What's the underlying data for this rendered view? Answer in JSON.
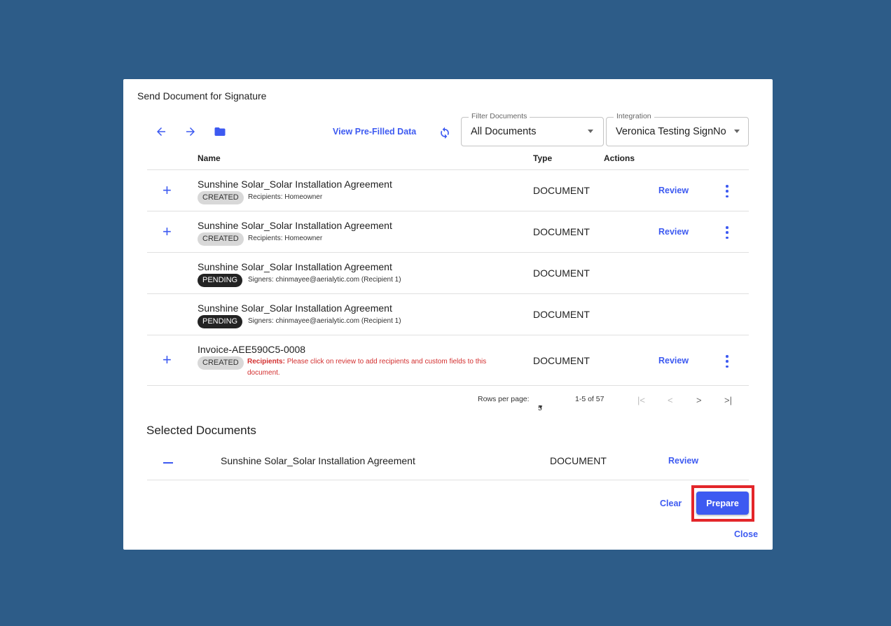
{
  "dialog": {
    "title": "Send Document for Signature"
  },
  "toolbar": {
    "back_icon": "arrow-left-icon",
    "forward_icon": "arrow-right-icon",
    "folder_icon": "folder-icon",
    "view_prefilled_label": "View Pre-Filled Data",
    "refresh_icon": "refresh-icon",
    "filter": {
      "label": "Filter Documents",
      "value": "All Documents"
    },
    "integration": {
      "label": "Integration",
      "value": "Veronica Testing SignNo"
    }
  },
  "table": {
    "headers": {
      "name": "Name",
      "type": "Type",
      "actions": "Actions"
    },
    "rows": [
      {
        "name": "Sunshine Solar_Solar Installation Agreement",
        "status": "CREATED",
        "meta": "Recipients: Homeowner",
        "type": "DOCUMENT",
        "review": "Review"
      },
      {
        "name": "Sunshine Solar_Solar Installation Agreement",
        "status": "CREATED",
        "meta": "Recipients: Homeowner",
        "type": "DOCUMENT",
        "review": "Review"
      },
      {
        "name": "Sunshine Solar_Solar Installation Agreement",
        "status": "PENDING",
        "meta": "Signers: chinmayee@aerialytic.com (Recipient 1)",
        "type": "DOCUMENT"
      },
      {
        "name": "Sunshine Solar_Solar Installation Agreement",
        "status": "PENDING",
        "meta": "Signers: chinmayee@aerialytic.com (Recipient 1)",
        "type": "DOCUMENT"
      },
      {
        "name": "Invoice-AEE590C5-0008",
        "status": "CREATED",
        "meta_label": "Recipients:",
        "meta": "Please click on review to add recipients and custom fields to this document.",
        "type": "DOCUMENT",
        "review": "Review"
      }
    ]
  },
  "pagination": {
    "rows_per_page_label": "Rows per page:",
    "rows_per_page": "5",
    "range": "1-5 of 57"
  },
  "selected": {
    "title": "Selected Documents",
    "items": [
      {
        "name": "Sunshine Solar_Solar Installation Agreement",
        "type": "DOCUMENT",
        "review": "Review"
      }
    ]
  },
  "footer": {
    "clear_label": "Clear",
    "prepare_label": "Prepare",
    "close_label": "Close"
  },
  "colors": {
    "backdrop": "#2d5c88",
    "accent": "#3d5af1",
    "highlight": "#e3262a",
    "warning": "#d32f2f"
  }
}
